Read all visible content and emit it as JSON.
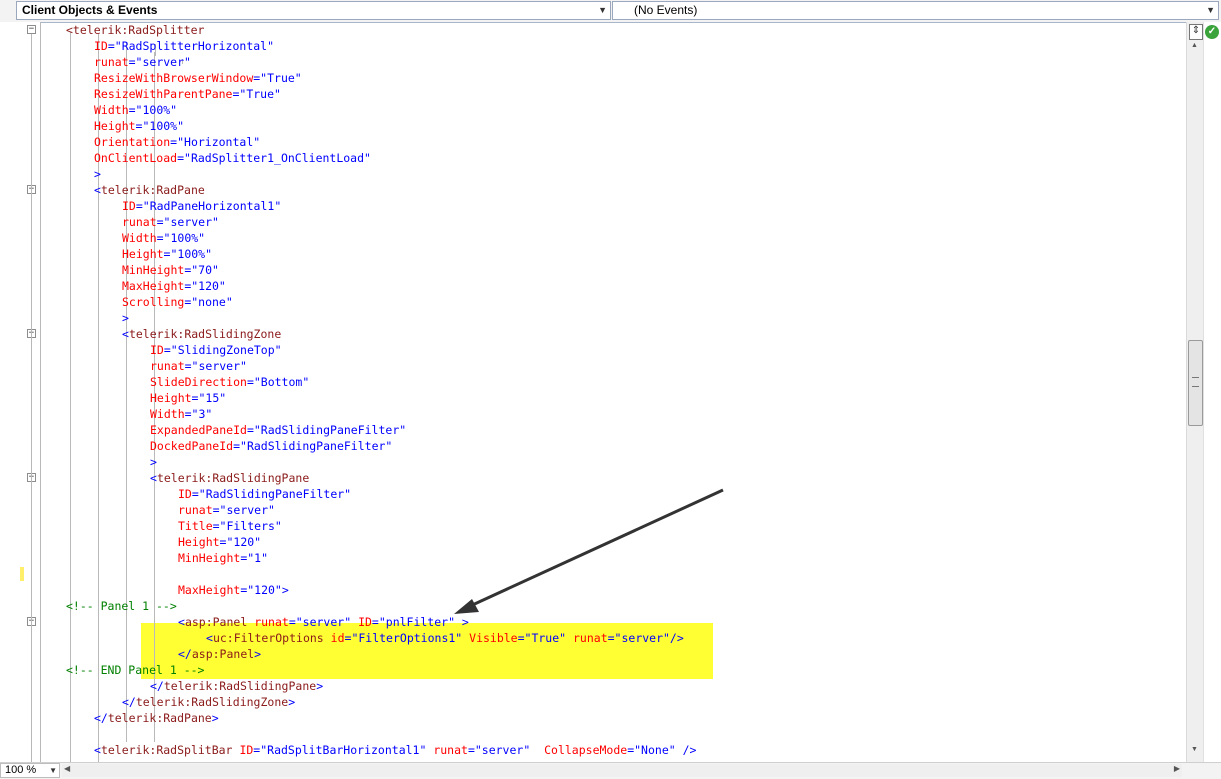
{
  "toolbar": {
    "object_dropdown": "Client Objects & Events",
    "event_dropdown": "(No Events)"
  },
  "statusbar": {
    "zoom": "100 %"
  },
  "code": {
    "lines": [
      [
        [
          "tg",
          "<telerik:RadSplitter"
        ]
      ],
      [
        [
          "at",
          "ID"
        ],
        [
          "pu",
          "=\"RadSplitterHorizontal\""
        ]
      ],
      [
        [
          "at",
          "runat"
        ],
        [
          "pu",
          "=\"server\""
        ]
      ],
      [
        [
          "at",
          "ResizeWithBrowserWindow"
        ],
        [
          "pu",
          "=\"True\""
        ]
      ],
      [
        [
          "at",
          "ResizeWithParentPane"
        ],
        [
          "pu",
          "=\"True\""
        ]
      ],
      [
        [
          "at",
          "Width"
        ],
        [
          "pu",
          "=\"100%\""
        ]
      ],
      [
        [
          "at",
          "Height"
        ],
        [
          "pu",
          "=\"100%\""
        ]
      ],
      [
        [
          "at",
          "Orientation"
        ],
        [
          "pu",
          "=\"Horizontal\""
        ]
      ],
      [
        [
          "at",
          "OnClientLoad"
        ],
        [
          "pu",
          "=\"RadSplitter1_OnClientLoad\""
        ]
      ],
      [
        [
          "pu",
          ">"
        ]
      ],
      [
        [
          "pu",
          "<"
        ],
        [
          "tg",
          "telerik:RadPane"
        ]
      ],
      [
        [
          "at",
          "ID"
        ],
        [
          "pu",
          "=\"RadPaneHorizontal1\""
        ]
      ],
      [
        [
          "at",
          "runat"
        ],
        [
          "pu",
          "=\"server\""
        ]
      ],
      [
        [
          "at",
          "Width"
        ],
        [
          "pu",
          "=\"100%\""
        ]
      ],
      [
        [
          "at",
          "Height"
        ],
        [
          "pu",
          "=\"100%\""
        ]
      ],
      [
        [
          "at",
          "MinHeight"
        ],
        [
          "pu",
          "=\"70\""
        ]
      ],
      [
        [
          "at",
          "MaxHeight"
        ],
        [
          "pu",
          "=\"120\""
        ]
      ],
      [
        [
          "at",
          "Scrolling"
        ],
        [
          "pu",
          "=\"none\""
        ]
      ],
      [
        [
          "pu",
          ">"
        ]
      ],
      [
        [
          "pu",
          "<"
        ],
        [
          "tg",
          "telerik:RadSlidingZone"
        ]
      ],
      [
        [
          "at",
          "ID"
        ],
        [
          "pu",
          "=\"SlidingZoneTop\""
        ]
      ],
      [
        [
          "at",
          "runat"
        ],
        [
          "pu",
          "=\"server\""
        ]
      ],
      [
        [
          "at",
          "SlideDirection"
        ],
        [
          "pu",
          "=\"Bottom\""
        ]
      ],
      [
        [
          "at",
          "Height"
        ],
        [
          "pu",
          "=\"15\""
        ]
      ],
      [
        [
          "at",
          "Width"
        ],
        [
          "pu",
          "=\"3\""
        ]
      ],
      [
        [
          "at",
          "ExpandedPaneId"
        ],
        [
          "pu",
          "=\"RadSlidingPaneFilter\""
        ]
      ],
      [
        [
          "at",
          "DockedPaneId"
        ],
        [
          "pu",
          "=\"RadSlidingPaneFilter\""
        ]
      ],
      [
        [
          "pu",
          ">"
        ]
      ],
      [
        [
          "pu",
          "<"
        ],
        [
          "tg",
          "telerik:RadSlidingPane"
        ]
      ],
      [
        [
          "at",
          "ID"
        ],
        [
          "pu",
          "=\"RadSlidingPaneFilter\""
        ]
      ],
      [
        [
          "at",
          "runat"
        ],
        [
          "pu",
          "=\"server\""
        ]
      ],
      [
        [
          "at",
          "Title"
        ],
        [
          "pu",
          "=\"Filters\""
        ]
      ],
      [
        [
          "at",
          "Height"
        ],
        [
          "pu",
          "=\"120\""
        ]
      ],
      [
        [
          "at",
          "MinHeight"
        ],
        [
          "pu",
          "=\"1\""
        ]
      ],
      [],
      [
        [
          "at",
          "MaxHeight"
        ],
        [
          "pu",
          "=\"120\">"
        ]
      ],
      [
        [
          "cm",
          "<!-- Panel 1 -->"
        ]
      ],
      [
        [
          "pu",
          "<"
        ],
        [
          "tg",
          "asp:Panel"
        ],
        [
          "pu",
          " "
        ],
        [
          "at",
          "runat"
        ],
        [
          "pu",
          "=\"server\" "
        ],
        [
          "at",
          "ID"
        ],
        [
          "pu",
          "=\"pnlFilter\" >"
        ]
      ],
      [
        [
          "pu",
          "<"
        ],
        [
          "tg",
          "uc:FilterOptions"
        ],
        [
          "pu",
          " "
        ],
        [
          "at",
          "id"
        ],
        [
          "pu",
          "=\"FilterOptions1\" "
        ],
        [
          "at",
          "Visible"
        ],
        [
          "pu",
          "=\"True\" "
        ],
        [
          "at",
          "runat"
        ],
        [
          "pu",
          "=\"server\"/>"
        ]
      ],
      [
        [
          "pu",
          "</"
        ],
        [
          "tg",
          "asp:Panel"
        ],
        [
          "pu",
          ">"
        ]
      ],
      [
        [
          "cm",
          "<!-- END Panel 1 -->"
        ]
      ],
      [
        [
          "pu",
          "</"
        ],
        [
          "tg",
          "telerik:RadSlidingPane"
        ],
        [
          "pu",
          ">"
        ]
      ],
      [
        [
          "pu",
          "</"
        ],
        [
          "tg",
          "telerik:RadSlidingZone"
        ],
        [
          "pu",
          ">"
        ]
      ],
      [
        [
          "pu",
          "</"
        ],
        [
          "tg",
          "telerik:RadPane"
        ],
        [
          "pu",
          ">"
        ]
      ],
      [],
      [
        [
          "pu",
          "<"
        ],
        [
          "tg",
          "telerik:RadSplitBar"
        ],
        [
          "pu",
          " "
        ],
        [
          "at",
          "ID"
        ],
        [
          "pu",
          "=\"RadSplitBarHorizontal1\" "
        ],
        [
          "at",
          "runat"
        ],
        [
          "pu",
          "=\"server\"  "
        ],
        [
          "at",
          "CollapseMode"
        ],
        [
          "pu",
          "=\"None\" />"
        ]
      ]
    ]
  }
}
